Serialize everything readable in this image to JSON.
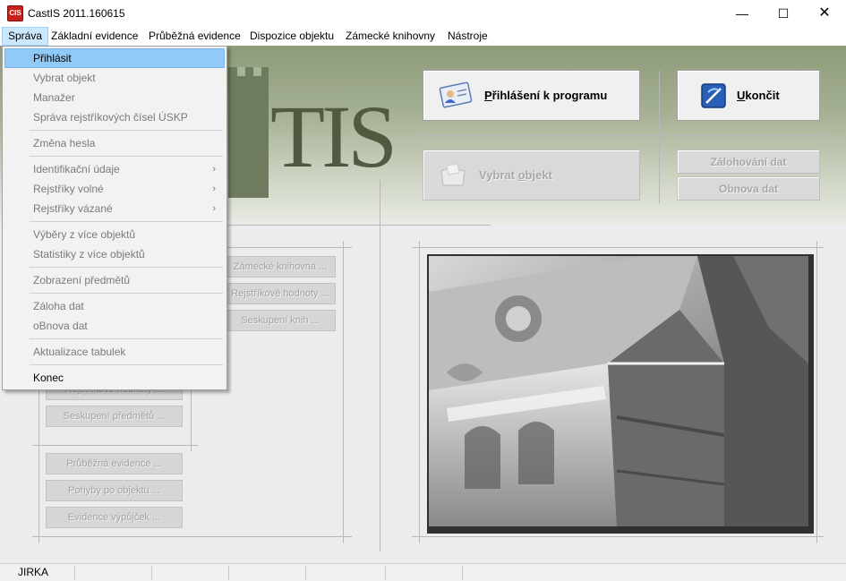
{
  "window": {
    "title": "CastIS 2011.160615",
    "icon_text": "CIS",
    "minimize_glyph": "—",
    "maximize_glyph": "☐",
    "close_glyph": "✕"
  },
  "menubar": {
    "items": [
      "Správa",
      "Základní evidence",
      "Průběžná evidence",
      "Dispozice objektu",
      "Zámecké knihovny",
      "Nástroje"
    ]
  },
  "logo": {
    "text": "TIS"
  },
  "buttons": {
    "login": {
      "pre": "",
      "ul": "P",
      "post": "řihlášení k programu"
    },
    "quit": {
      "pre": "",
      "ul": "U",
      "post": "končit"
    },
    "select_object": {
      "pre": "Vybrat ",
      "ul": "o",
      "post": "bjekt"
    },
    "backup": "Zálohování dat",
    "restore": "Obnova dat"
  },
  "left_panel": {
    "buttons": [
      "Zámecké knihovna ...",
      "Rejstříkové hodnoty ...",
      "Seskupení knih ...",
      "Rejstříkové hodnoty ...",
      "Seskupení předmětů ...",
      "Průběžná evidence ...",
      "Pohyby po objektu ...",
      "Evidence výpůjček ..."
    ]
  },
  "dropdown": {
    "items": [
      {
        "label": "Přihlásit",
        "enabled": true,
        "highlighted": true,
        "submenu": false
      },
      {
        "label": "Vybrat objekt",
        "enabled": false,
        "highlighted": false,
        "submenu": false
      },
      {
        "label": "Manažer",
        "enabled": false,
        "highlighted": false,
        "submenu": false
      },
      {
        "label": "Správa rejstříkových čísel ÚSKP",
        "enabled": false,
        "highlighted": false,
        "submenu": false
      },
      {
        "label": "Změna hesla",
        "enabled": false,
        "highlighted": false,
        "submenu": false
      },
      {
        "label": "Identifikační údaje",
        "enabled": false,
        "highlighted": false,
        "submenu": true
      },
      {
        "label": "Rejstříky volné",
        "enabled": false,
        "highlighted": false,
        "submenu": true
      },
      {
        "label": "Rejstříky vázané",
        "enabled": false,
        "highlighted": false,
        "submenu": true
      },
      {
        "label": "Výběry z více objektů",
        "enabled": false,
        "highlighted": false,
        "submenu": false
      },
      {
        "label": "Statistiky z více objektů",
        "enabled": false,
        "highlighted": false,
        "submenu": false
      },
      {
        "label": "Zobrazení předmětů",
        "enabled": false,
        "highlighted": false,
        "submenu": false
      },
      {
        "label": "Záloha dat",
        "enabled": false,
        "highlighted": false,
        "submenu": false
      },
      {
        "label": "oBnova dat",
        "enabled": false,
        "highlighted": false,
        "submenu": false
      },
      {
        "label": "Aktualizace tabulek",
        "enabled": false,
        "highlighted": false,
        "submenu": false
      },
      {
        "label": "Konec",
        "enabled": true,
        "highlighted": false,
        "submenu": false
      }
    ],
    "submenu_glyph": "›"
  },
  "statusbar": {
    "cells": [
      "JIRKA",
      "",
      "",
      "",
      "",
      ""
    ]
  },
  "colors": {
    "highlight": "#91c9f7",
    "banner": "#a7b296",
    "disabled_text": "#a3a3a3",
    "app_icon": "#c8201a"
  }
}
